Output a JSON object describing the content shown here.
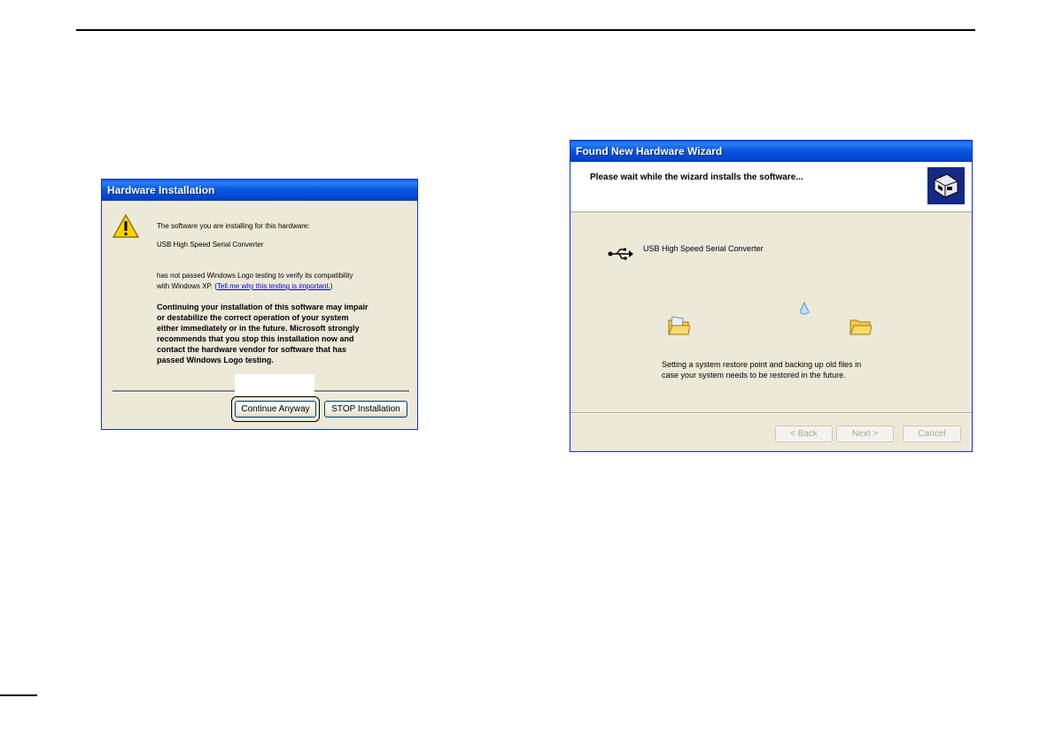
{
  "hardware_installation": {
    "title": "Hardware Installation",
    "line1": "The software you are installing for this hardware:",
    "device": "USB High Speed Serial Converter",
    "line3a": "has not passed Windows Logo testing to verify its compatibility",
    "line3b_prefix": "with Windows XP. (",
    "link": "Tell me why this testing is important.",
    "line3b_suffix": ")",
    "warning": [
      "Continuing your installation of this software may impair",
      "or destabilize the correct operation of your system",
      "either immediately or in the future. Microsoft strongly",
      "recommends that you stop this installation now and",
      "contact the hardware vendor for software that has",
      "passed Windows Logo testing."
    ],
    "continue_button": "Continue Anyway",
    "stop_button": "STOP Installation"
  },
  "wizard": {
    "title": "Found New Hardware Wizard",
    "header": "Please wait while the wizard installs the software...",
    "device": "USB High Speed Serial Converter",
    "status": [
      "Setting a system restore point and backing up old files in",
      "case your system needs to be restored in the future."
    ],
    "back_button": "< Back",
    "next_button": "Next >",
    "cancel_button": "Cancel"
  },
  "icons": {
    "warning": "warning-icon",
    "usb": "usb-icon",
    "wizard": "hardware-wizard-icon",
    "folder": "folder-icon",
    "paper": "flying-paper-icon"
  }
}
